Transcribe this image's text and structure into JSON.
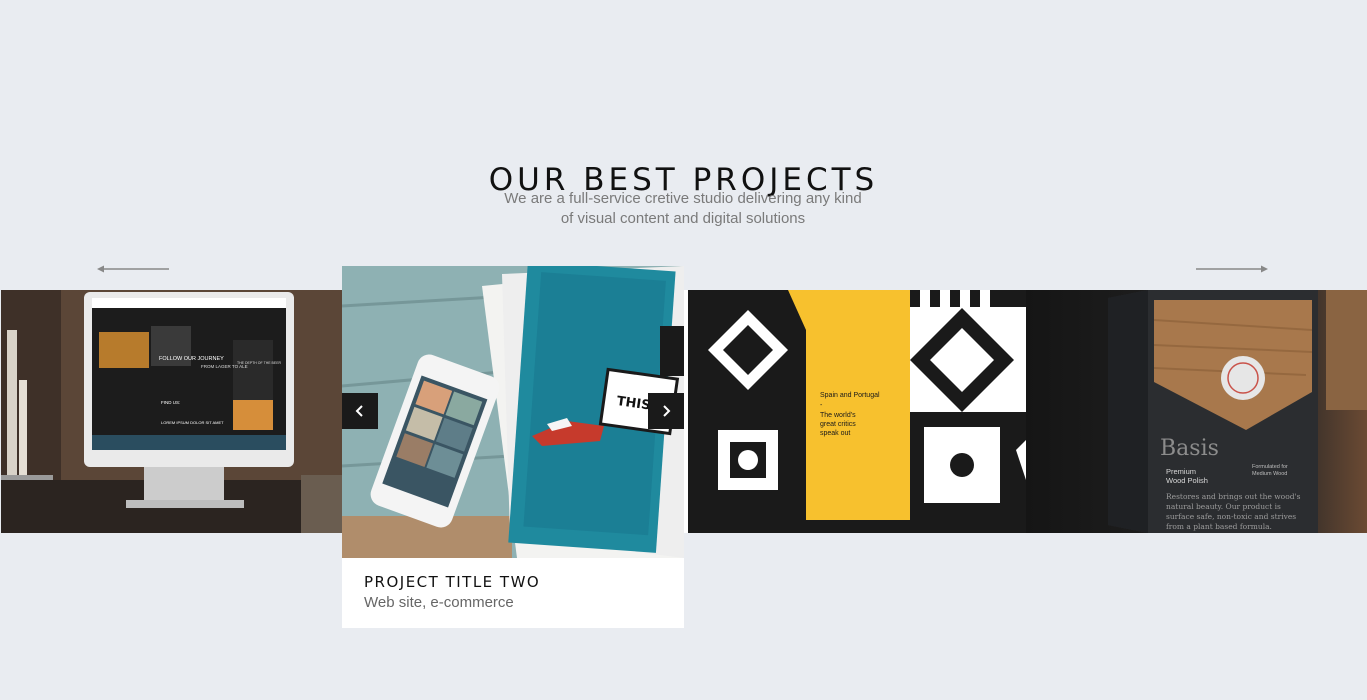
{
  "section": {
    "title": "OUR BEST PROJECTS",
    "subtitle_line1": "We are a full-service cretive studio delivering any kind",
    "subtitle_line2": "of visual content and digital solutions"
  },
  "slider": {
    "active_card": {
      "title": "PROJECT TITLE TWO",
      "subtitle": "Web site, e-commerce"
    },
    "slides": [
      {
        "screen_texts": [
          "FOLLOW OUR JOURNEY",
          "FROM LAGER TO ALE",
          "THE DEPTH OF THE BEER",
          "FIND US:",
          "LOREM IPSUM DOLOR SIT AMET"
        ]
      },
      {
        "magazine_text": "THIS ADVE"
      },
      {
        "poster_line1": "Spain and Portugal",
        "poster_line2": "-",
        "poster_line3": "The world's",
        "poster_line4": "great critics",
        "poster_line5": "speak out"
      },
      {
        "brand": "Basis",
        "product_line1": "Premium",
        "product_line2": "Wood Polish",
        "note_line1": "Formulated for",
        "note_line2": "Medium Wood",
        "body_line1": "Restores and brings out the wood's",
        "body_line2": "natural beauty. Our product is",
        "body_line3": "surface safe, non-toxic and strives",
        "body_line4": "from a plant based formula."
      }
    ]
  },
  "colors": {
    "background": "#e9ecf1",
    "accent_yellow": "#f7c12e",
    "nav_button": "#1a1a1a"
  }
}
